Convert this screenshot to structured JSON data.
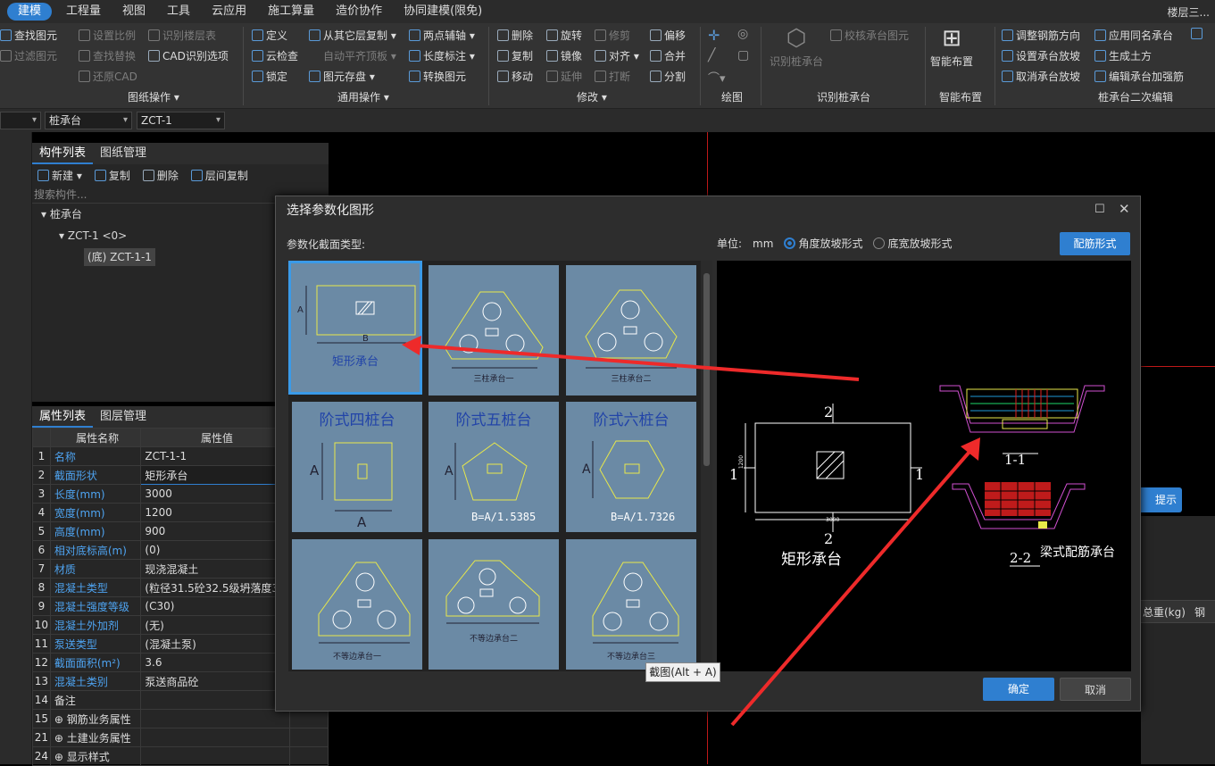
{
  "menu": {
    "items": [
      "建模",
      "工程量",
      "视图",
      "工具",
      "云应用",
      "施工算量",
      "造价协作",
      "协同建模(限免)"
    ],
    "right": "楼层三..."
  },
  "ribbon": {
    "col1": [
      "查找图元",
      "过滤图元"
    ],
    "col2": [
      "设置比例",
      "查找替换",
      "还原CAD"
    ],
    "col3": [
      "识别楼层表",
      "CAD识别选项"
    ],
    "group1": "图纸操作 ▾",
    "col4": [
      "定义",
      "云检查",
      "锁定"
    ],
    "col5": [
      "从其它层复制 ▾",
      "自动平齐顶板 ▾",
      "图元存盘 ▾"
    ],
    "col6": [
      "两点辅轴 ▾",
      "长度标注 ▾",
      "转换图元"
    ],
    "group2": "通用操作 ▾",
    "col7": [
      "删除",
      "复制",
      "移动"
    ],
    "col8": [
      "旋转",
      "镜像",
      "延伸"
    ],
    "col9": [
      "修剪",
      "对齐 ▾",
      "打断"
    ],
    "col10": [
      "偏移",
      "合并",
      "分割"
    ],
    "group3": "修改 ▾",
    "group4": "绘图",
    "identify_pile": "识别桩承台",
    "check_pile": "校核承台图元",
    "group5": "识别桩承台",
    "smart_layout": "智能布置",
    "group6": "智能布置",
    "col11": [
      "调整钢筋方向",
      "设置承台放坡",
      "取消承台放坡"
    ],
    "col12": [
      "应用同名承台",
      "生成土方",
      "编辑承台加强筋"
    ],
    "group7": "桩承台二次编辑"
  },
  "selectors": {
    "type": "桩承台",
    "name": "ZCT-1"
  },
  "component_panel": {
    "tabs": [
      "构件列表",
      "图纸管理"
    ],
    "toolbar": [
      "新建 ▾",
      "复制",
      "删除",
      "层间复制"
    ],
    "search_placeholder": "搜索构件...",
    "tree": [
      "桩承台",
      "ZCT-1 <0>",
      "(底) ZCT-1-1"
    ]
  },
  "property_panel": {
    "tabs": [
      "属性列表",
      "图层管理"
    ],
    "headers": [
      "属性名称",
      "属性值"
    ],
    "rows": [
      {
        "n": "1",
        "k": "名称",
        "v": "ZCT-1-1"
      },
      {
        "n": "2",
        "k": "截面形状",
        "v": "矩形承台"
      },
      {
        "n": "3",
        "k": "长度(mm)",
        "v": "3000"
      },
      {
        "n": "4",
        "k": "宽度(mm)",
        "v": "1200"
      },
      {
        "n": "5",
        "k": "高度(mm)",
        "v": "900"
      },
      {
        "n": "6",
        "k": "相对底标高(m)",
        "v": "(0)"
      },
      {
        "n": "7",
        "k": "材质",
        "v": "现浇混凝土"
      },
      {
        "n": "8",
        "k": "混凝土类型",
        "v": "(粒径31.5砼32.5级坍落度3..."
      },
      {
        "n": "9",
        "k": "混凝土强度等级",
        "v": "(C30)"
      },
      {
        "n": "10",
        "k": "混凝土外加剂",
        "v": "(无)"
      },
      {
        "n": "11",
        "k": "泵送类型",
        "v": "(混凝土泵)"
      },
      {
        "n": "12",
        "k": "截面面积(m²)",
        "v": "3.6"
      },
      {
        "n": "13",
        "k": "混凝土类别",
        "v": "泵送商品砼"
      },
      {
        "n": "14",
        "k": "备注",
        "v": ""
      },
      {
        "n": "15",
        "k": "⊕ 钢筋业务属性",
        "v": ""
      },
      {
        "n": "21",
        "k": "⊕ 土建业务属性",
        "v": ""
      },
      {
        "n": "24",
        "k": "⊕ 显示样式",
        "v": ""
      }
    ]
  },
  "background": {
    "hint": "提示",
    "total_weight": "总重(kg)",
    "partial": "钢"
  },
  "dialog": {
    "title": "选择参数化图形",
    "type_label": "参数化截面类型:",
    "unit_label": "单位:",
    "unit": "mm",
    "radio1": "角度放坡形式",
    "radio2": "底宽放坡形式",
    "rebar_form": "配筋形式",
    "shapes": [
      "矩形承台",
      "三柱承台一",
      "三柱承台二",
      "阶式四桩台",
      "阶式五桩台",
      "阶式六桩台",
      "不等边承台一",
      "不等边承台二",
      "不等边承台三"
    ],
    "formulas": {
      "five": "B=A/1.5385",
      "six": "B=A/1.7326"
    },
    "preview": {
      "name": "矩形承台",
      "beam_name": "梁式配筋承台",
      "sec11": "1-1",
      "sec22": "2-2",
      "dim_w": "3000",
      "dim_h": "1200",
      "tag1": "1",
      "tag2": "2"
    },
    "ok": "确定",
    "cancel": "取消"
  },
  "tooltip": "截图(Alt + A)"
}
